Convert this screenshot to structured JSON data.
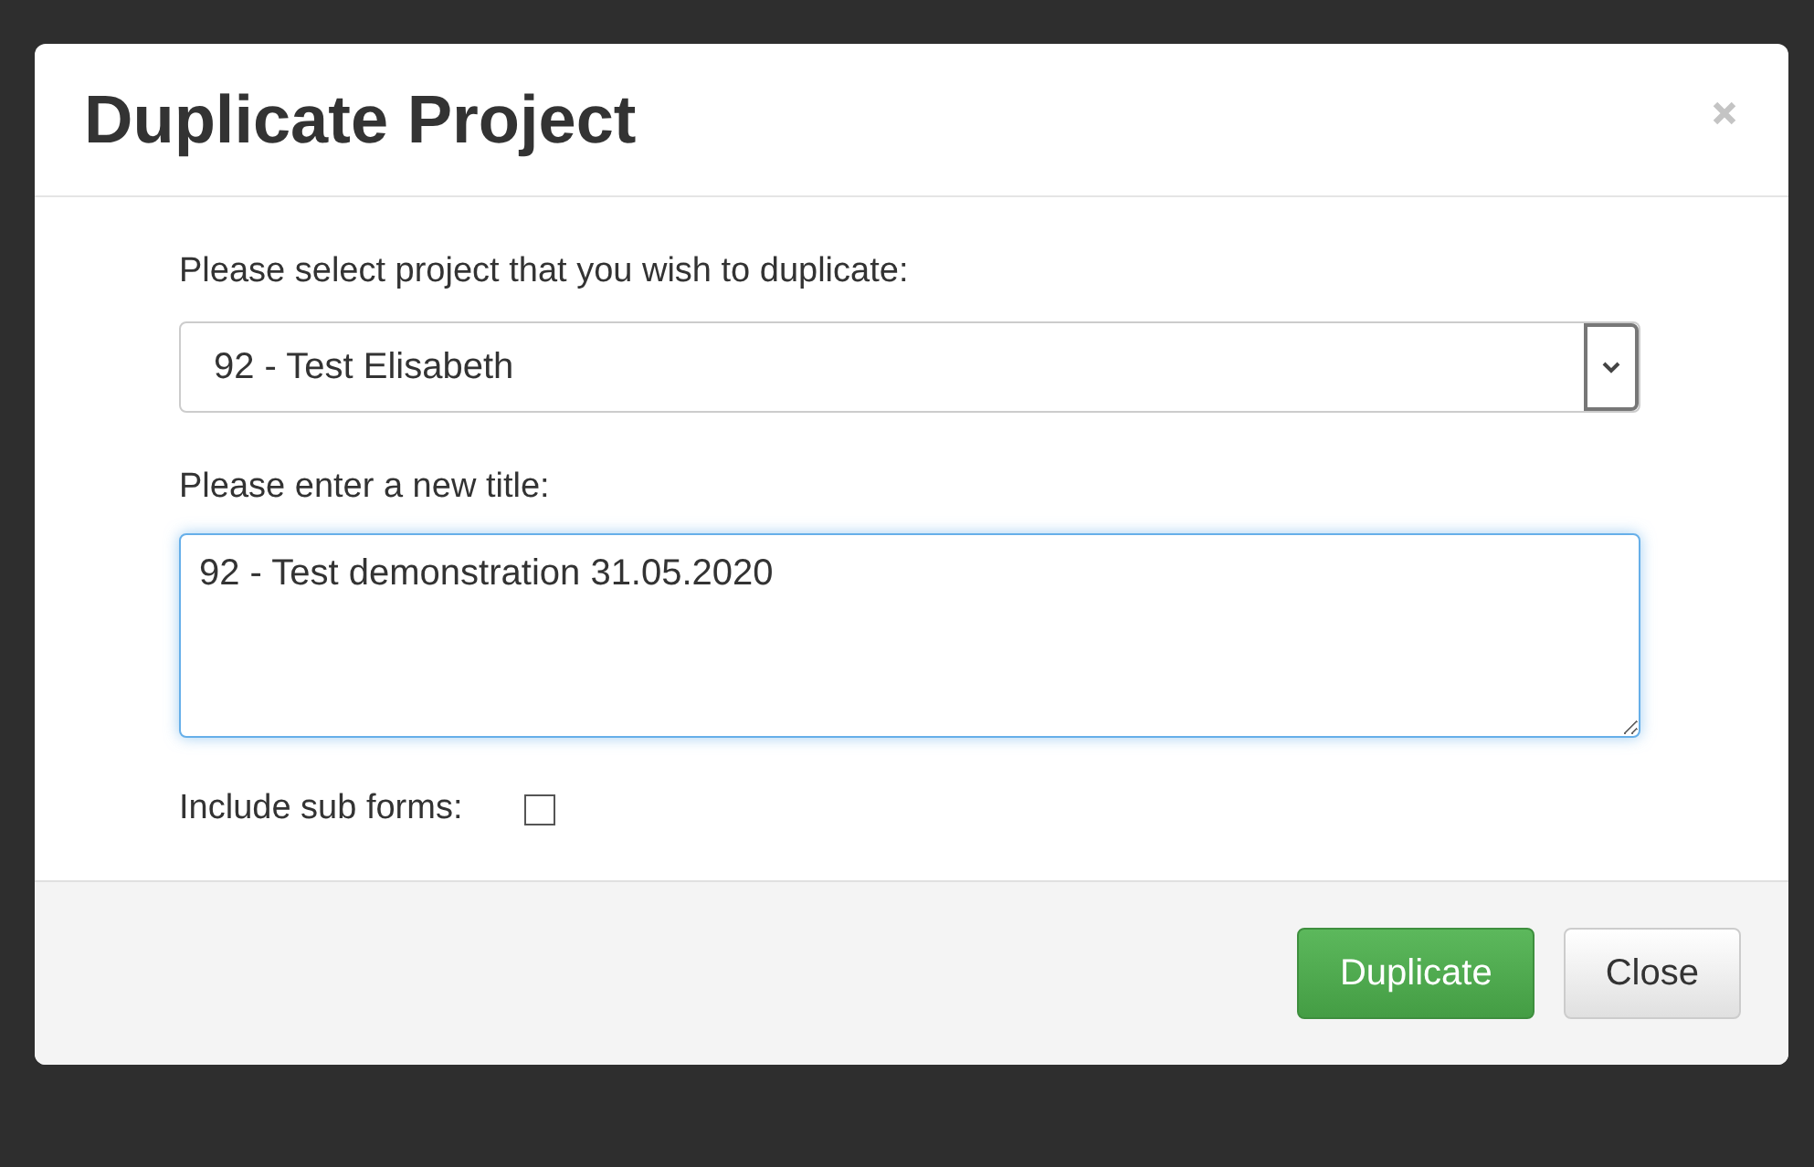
{
  "dialog": {
    "title": "Duplicate Project",
    "project_label": "Please select project that you wish to duplicate:",
    "project_select": {
      "value": "92 - Test Elisabeth"
    },
    "title_label": "Please enter a new title:",
    "title_field": {
      "value": "92 - Test demonstration 31.05.2020",
      "focused": true
    },
    "sub_forms": {
      "label": "Include sub forms:",
      "checked": false
    },
    "buttons": [
      {
        "label": "Duplicate",
        "kind": "primary"
      },
      {
        "label": "Close",
        "kind": "default"
      }
    ]
  }
}
